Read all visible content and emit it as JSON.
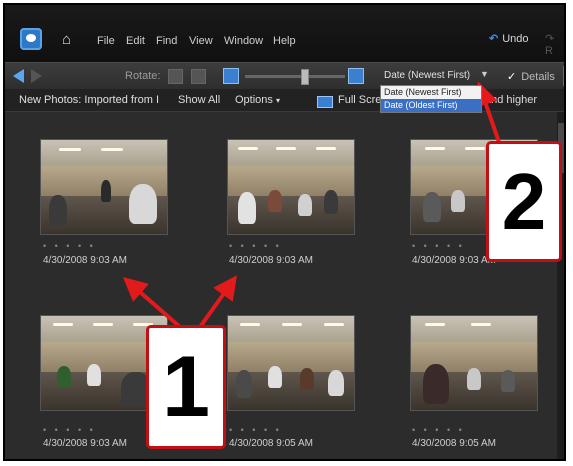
{
  "menu": {
    "items": [
      "File",
      "Edit",
      "Find",
      "View",
      "Window",
      "Help"
    ],
    "undo_label": "Undo",
    "redo_label": "R"
  },
  "toolbar": {
    "rotate_label": "Rotate:",
    "sort_value": "Date (Newest First)",
    "sort_options": [
      "Date (Newest First)",
      "Date (Oldest First)"
    ],
    "details_label": "Details",
    "details_checked": true
  },
  "subbar": {
    "breadcrumb": "New Photos: Imported from I",
    "show_all": "Show All",
    "options": "Options",
    "full_screen": "Full Scre",
    "rating_filter": "and higher"
  },
  "photos": [
    {
      "date": "4/30/2008 9:03 AM",
      "stars": "• • • • •"
    },
    {
      "date": "4/30/2008 9:03 AM",
      "stars": "• • • • •"
    },
    {
      "date": "4/30/2008 9:03 AM",
      "stars": "• • • • •"
    },
    {
      "date": "4/30/2008 9:03 AM",
      "stars": "• • • • •"
    },
    {
      "date": "4/30/2008 9:05 AM",
      "stars": "• • • • •"
    },
    {
      "date": "4/30/2008 9:05 AM",
      "stars": "• • • • •"
    }
  ],
  "callouts": {
    "one": "1",
    "two": "2"
  },
  "colors": {
    "callout_border": "#c40f12",
    "accent": "#2d79c7"
  }
}
